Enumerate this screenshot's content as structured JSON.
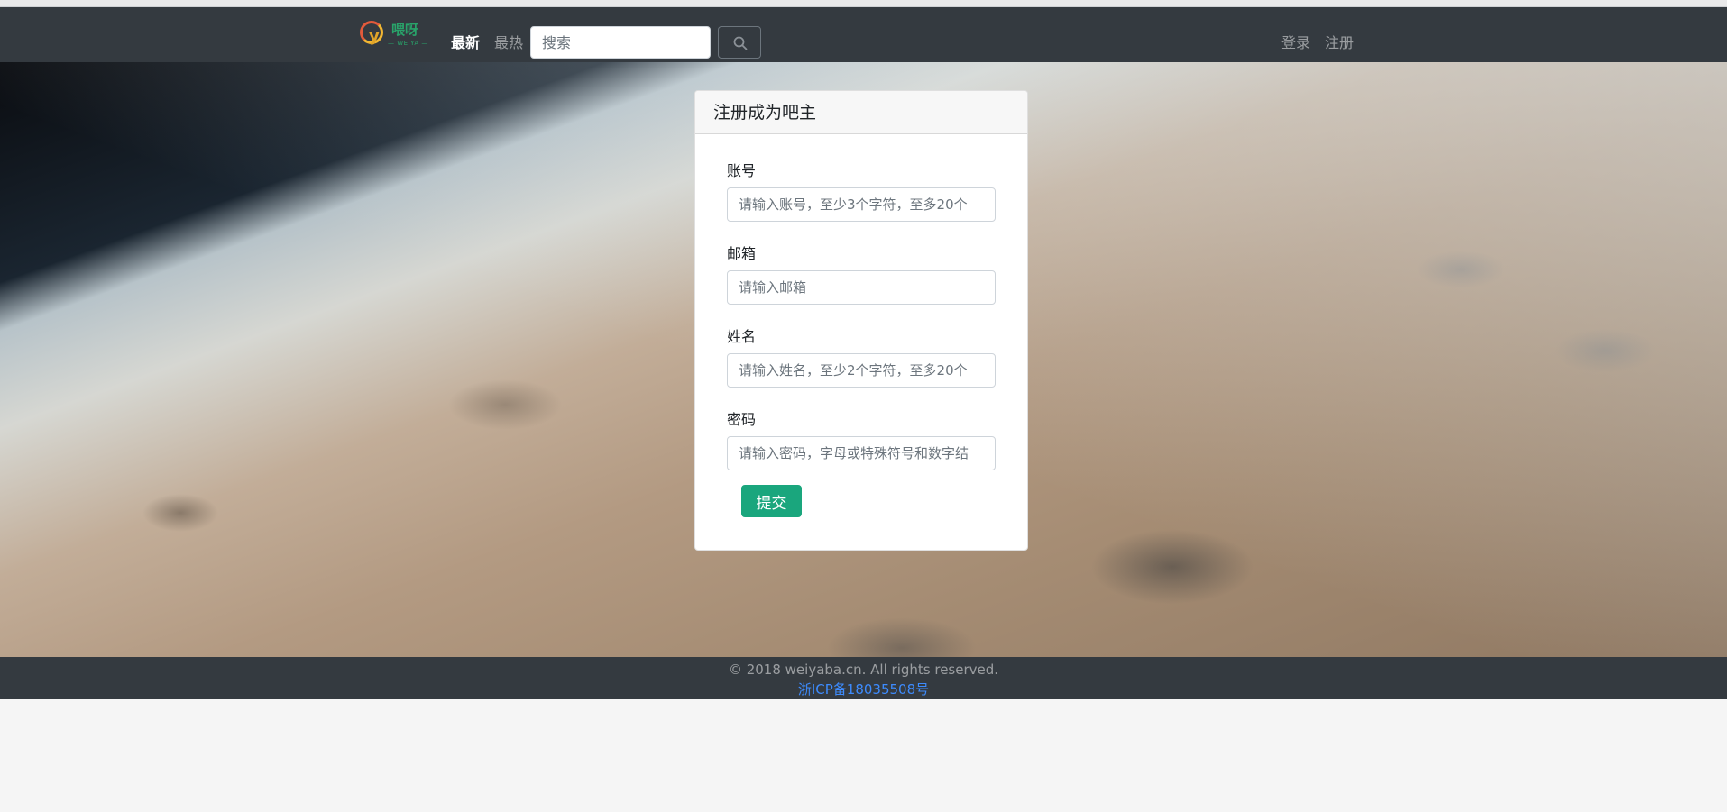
{
  "nav": {
    "logo_word": "喂呀",
    "logo_sub": "— WEIYA —",
    "links": [
      {
        "label": "最新",
        "active": true
      },
      {
        "label": "最热",
        "active": false
      }
    ],
    "search_placeholder": "搜索",
    "login": "登录",
    "register": "注册"
  },
  "form": {
    "title": "注册成为吧主",
    "fields": [
      {
        "label": "账号",
        "placeholder": "请输入账号，至少3个字符，至多20个"
      },
      {
        "label": "邮箱",
        "placeholder": "请输入邮箱"
      },
      {
        "label": "姓名",
        "placeholder": "请输入姓名，至少2个字符，至多20个"
      },
      {
        "label": "密码",
        "placeholder": "请输入密码，字母或特殊符号和数字结"
      }
    ],
    "submit": "提交"
  },
  "footer": {
    "copyright": "© 2018 weiyaba.cn. All rights reserved.",
    "icp": "浙ICP备18035508号"
  },
  "colors": {
    "navbar": "#343a40",
    "submit": "#1aa67d",
    "icp_link": "#3d8bfd"
  }
}
